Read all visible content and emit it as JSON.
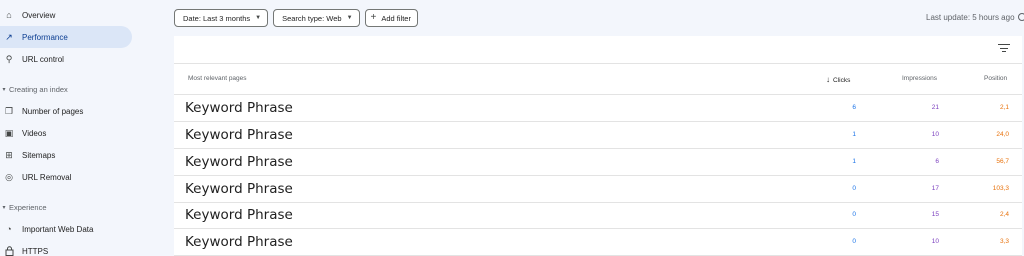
{
  "sidebar": {
    "items_top": [
      {
        "label": "Overview",
        "icon": "home-icon",
        "glyph": "⌂"
      },
      {
        "label": "Performance",
        "icon": "trending-up-icon",
        "glyph": "↗"
      },
      {
        "label": "URL control",
        "icon": "search-icon",
        "glyph": "⚲"
      }
    ],
    "section_index": "Creating an index",
    "items_index": [
      {
        "label": "Number of pages",
        "icon": "pages-icon",
        "glyph": "❐"
      },
      {
        "label": "Videos",
        "icon": "video-icon",
        "glyph": "▣"
      },
      {
        "label": "Sitemaps",
        "icon": "sitemap-icon",
        "glyph": "⊞"
      },
      {
        "label": "URL Removal",
        "icon": "eye-off-icon",
        "glyph": "◎"
      }
    ],
    "section_experience": "Experience",
    "items_experience": [
      {
        "label": "Important Web Data",
        "icon": "gauge-icon",
        "glyph": "◔"
      },
      {
        "label": "HTTPS",
        "icon": "lock-icon",
        "glyph": "🔒"
      }
    ]
  },
  "toolbar": {
    "date_label": "Date: Last 3 months",
    "search_type_label": "Search type: Web",
    "add_filter_label": "Add filter",
    "last_update": "Last update: 5 hours ago"
  },
  "table": {
    "headers": {
      "page": "Most relevant pages",
      "clicks": "Clicks",
      "impressions": "Impressions",
      "position": "Position"
    },
    "rows": [
      {
        "page": "Keyword Phrase",
        "clicks": "6",
        "impressions": "21",
        "position": "2,1"
      },
      {
        "page": "Keyword Phrase",
        "clicks": "1",
        "impressions": "10",
        "position": "24,0"
      },
      {
        "page": "Keyword Phrase",
        "clicks": "1",
        "impressions": "6",
        "position": "56,7"
      },
      {
        "page": "Keyword Phrase",
        "clicks": "0",
        "impressions": "17",
        "position": "103,3"
      },
      {
        "page": "Keyword Phrase",
        "clicks": "0",
        "impressions": "15",
        "position": "2,4"
      },
      {
        "page": "Keyword Phrase",
        "clicks": "0",
        "impressions": "10",
        "position": "3,3"
      }
    ]
  },
  "colors": {
    "clicks": "#1a73e8",
    "impressions": "#7b3fbf",
    "position": "#e8710a",
    "active_nav": "#dbe6f7"
  }
}
